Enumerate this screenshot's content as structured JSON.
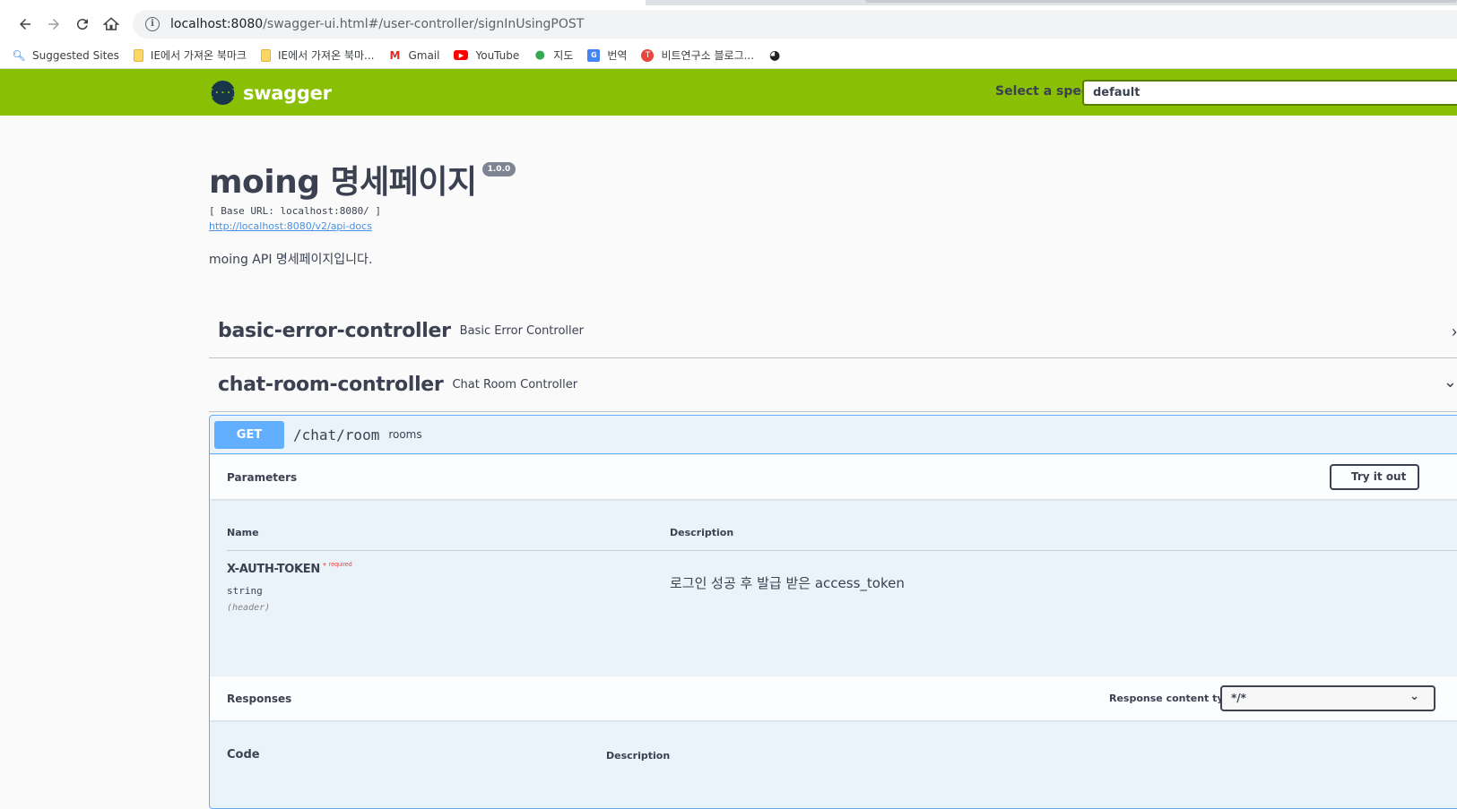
{
  "browser": {
    "url_host": "localhost:8080",
    "url_path": "/swagger-ui.html#/user-controller/signInUsingPOST",
    "bookmarks": [
      {
        "label": "Suggested Sites",
        "icon": "search-icon"
      },
      {
        "label": "IE에서 가져온 북마크",
        "icon": "folder-icon"
      },
      {
        "label": "IE에서 가져온 북마...",
        "icon": "folder-icon"
      },
      {
        "label": "Gmail",
        "icon": "gmail-icon"
      },
      {
        "label": "YouTube",
        "icon": "youtube-icon"
      },
      {
        "label": "지도",
        "icon": "maps-icon"
      },
      {
        "label": "번역",
        "icon": "translate-icon"
      },
      {
        "label": "비트연구소 블로그...",
        "icon": "blog-icon"
      }
    ]
  },
  "topbar": {
    "logo_text": "swagger",
    "logo_mark": "{···}",
    "spec_label": "Select a spec",
    "spec_value": "default"
  },
  "info": {
    "title": "moing 명세페이지",
    "version": "1.0.0",
    "base_url": "[ Base URL: localhost:8080/ ]",
    "api_docs_link": "http://localhost:8080/v2/api-docs",
    "description": "moing API 명세페이지입니다."
  },
  "controllers": [
    {
      "name": "basic-error-controller",
      "description": "Basic Error Controller"
    },
    {
      "name": "chat-room-controller",
      "description": "Chat Room Controller"
    }
  ],
  "operation": {
    "method": "GET",
    "path": "/chat/room",
    "summary": "rooms",
    "parameters_title": "Parameters",
    "try_it_out_label": "Try it out",
    "col_name": "Name",
    "col_description": "Description",
    "param": {
      "name": "X-AUTH-TOKEN",
      "required_star": "*",
      "required_label": "required",
      "type": "string",
      "in": "(header)",
      "description": "로그인 성공 후 발급 받은 access_token"
    },
    "responses_title": "Responses",
    "response_content_type_label": "Response content type",
    "response_content_type_value": "*/*",
    "col_code": "Code",
    "col_resp_description": "Description"
  },
  "colors": {
    "topbar": "#89bf04",
    "get_method": "#61affe",
    "required": "#ff4136"
  }
}
